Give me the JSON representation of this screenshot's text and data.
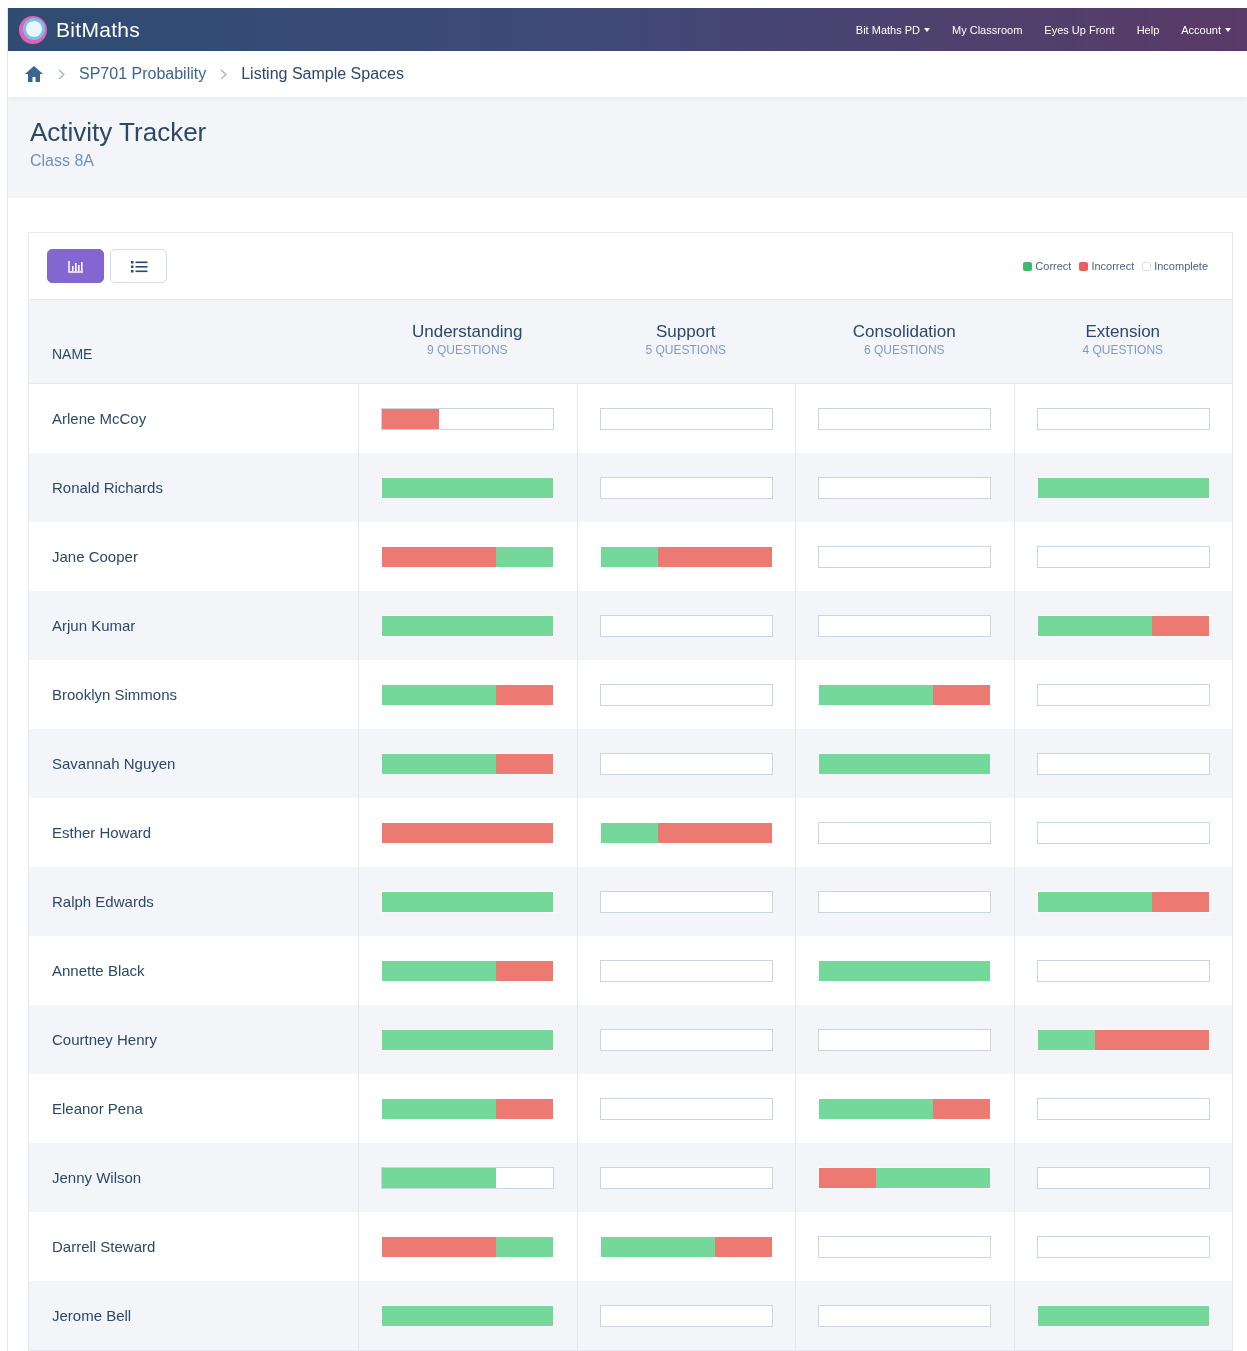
{
  "navbar": {
    "brand": "BitMaths",
    "links": [
      {
        "label": "Bit Maths PD",
        "dropdown": true
      },
      {
        "label": "My Classroom",
        "dropdown": false
      },
      {
        "label": "Eyes Up Front",
        "dropdown": false
      },
      {
        "label": "Help",
        "dropdown": false
      },
      {
        "label": "Account",
        "dropdown": true
      }
    ]
  },
  "breadcrumb": [
    "SP701 Probability",
    "Listing Sample Spaces"
  ],
  "page": {
    "title": "Activity Tracker",
    "subtitle": "Class 8A"
  },
  "view_buttons": [
    {
      "kind": "chart",
      "selected": true
    },
    {
      "kind": "list",
      "selected": false
    }
  ],
  "legend": [
    {
      "label": "Correct",
      "color": "#3dba6b"
    },
    {
      "label": "Incorrect",
      "color": "#e5615c"
    },
    {
      "label": "Incomplete",
      "color": "#ffffff"
    }
  ],
  "table": {
    "name_column": "NAME",
    "columns": [
      {
        "title": "Understanding",
        "count": "9 QUESTIONS"
      },
      {
        "title": "Support",
        "count": "5 QUESTIONS"
      },
      {
        "title": "Consolidation",
        "count": "6 QUESTIONS"
      },
      {
        "title": "Extension",
        "count": "4 QUESTIONS"
      }
    ],
    "rows": [
      {
        "name": "Arlene McCoy",
        "cells": [
          {
            "complete": false,
            "segments": [
              {
                "kind": "incorrect",
                "level": 0.333
              }
            ]
          },
          {
            "complete": false
          },
          {
            "complete": false
          },
          {
            "complete": false
          }
        ]
      },
      {
        "name": "Ronald Richards",
        "cells": [
          {
            "complete": true,
            "segments": [
              {
                "kind": "correct",
                "level": 1
              }
            ]
          },
          {
            "complete": false
          },
          {
            "complete": false
          },
          {
            "complete": true,
            "segments": [
              {
                "kind": "correct",
                "level": 1
              }
            ]
          }
        ]
      },
      {
        "name": "Jane Cooper",
        "cells": [
          {
            "complete": true,
            "segments": [
              {
                "kind": "incorrect",
                "level": 0.667
              },
              {
                "kind": "correct",
                "level": 0.333
              }
            ]
          },
          {
            "complete": true,
            "segments": [
              {
                "kind": "correct",
                "level": 0.333
              },
              {
                "kind": "incorrect",
                "level": 0.667
              }
            ]
          },
          {
            "complete": false
          },
          {
            "complete": false
          }
        ]
      },
      {
        "name": "Arjun Kumar",
        "cells": [
          {
            "complete": true,
            "segments": [
              {
                "kind": "correct",
                "level": 1
              }
            ]
          },
          {
            "complete": false
          },
          {
            "complete": false
          },
          {
            "complete": true,
            "segments": [
              {
                "kind": "correct",
                "level": 0.667
              },
              {
                "kind": "incorrect",
                "level": 0.333
              }
            ]
          }
        ]
      },
      {
        "name": "Brooklyn Simmons",
        "cells": [
          {
            "complete": true,
            "segments": [
              {
                "kind": "correct",
                "level": 0.667
              },
              {
                "kind": "incorrect",
                "level": 0.333
              }
            ]
          },
          {
            "complete": false
          },
          {
            "complete": true,
            "segments": [
              {
                "kind": "correct",
                "level": 0.667
              },
              {
                "kind": "incorrect",
                "level": 0.333
              }
            ]
          },
          {
            "complete": false
          }
        ]
      },
      {
        "name": "Savannah Nguyen",
        "cells": [
          {
            "complete": true,
            "segments": [
              {
                "kind": "correct",
                "level": 0.667
              },
              {
                "kind": "incorrect",
                "level": 0.333
              }
            ]
          },
          {
            "complete": false
          },
          {
            "complete": true,
            "segments": [
              {
                "kind": "correct",
                "level": 1
              }
            ]
          },
          {
            "complete": false
          }
        ]
      },
      {
        "name": "Esther Howard",
        "cells": [
          {
            "complete": true,
            "segments": [
              {
                "kind": "incorrect",
                "level": 1
              }
            ]
          },
          {
            "complete": true,
            "segments": [
              {
                "kind": "correct",
                "level": 0.333
              },
              {
                "kind": "incorrect",
                "level": 0.667
              }
            ]
          },
          {
            "complete": false
          },
          {
            "complete": false
          }
        ]
      },
      {
        "name": "Ralph Edwards",
        "cells": [
          {
            "complete": true,
            "segments": [
              {
                "kind": "correct",
                "level": 1
              }
            ]
          },
          {
            "complete": false
          },
          {
            "complete": false
          },
          {
            "complete": true,
            "segments": [
              {
                "kind": "correct",
                "level": 0.667
              },
              {
                "kind": "incorrect",
                "level": 0.333
              }
            ]
          }
        ]
      },
      {
        "name": "Annette Black",
        "cells": [
          {
            "complete": true,
            "segments": [
              {
                "kind": "correct",
                "level": 0.667
              },
              {
                "kind": "incorrect",
                "level": 0.333
              }
            ]
          },
          {
            "complete": false
          },
          {
            "complete": true,
            "segments": [
              {
                "kind": "correct",
                "level": 1
              }
            ]
          },
          {
            "complete": false
          }
        ]
      },
      {
        "name": "Courtney Henry",
        "cells": [
          {
            "complete": true,
            "segments": [
              {
                "kind": "correct",
                "level": 1
              }
            ]
          },
          {
            "complete": false
          },
          {
            "complete": false
          },
          {
            "complete": true,
            "segments": [
              {
                "kind": "correct",
                "level": 0.333
              },
              {
                "kind": "incorrect",
                "level": 0.667
              }
            ]
          }
        ]
      },
      {
        "name": "Eleanor Pena",
        "cells": [
          {
            "complete": true,
            "segments": [
              {
                "kind": "correct",
                "level": 0.667
              },
              {
                "kind": "incorrect",
                "level": 0.333
              }
            ]
          },
          {
            "complete": false
          },
          {
            "complete": true,
            "segments": [
              {
                "kind": "correct",
                "level": 0.667
              },
              {
                "kind": "incorrect",
                "level": 0.333
              }
            ]
          },
          {
            "complete": false
          }
        ]
      },
      {
        "name": "Jenny Wilson",
        "cells": [
          {
            "complete": false,
            "segments": [
              {
                "kind": "correct",
                "level": 0.667
              }
            ]
          },
          {
            "complete": false
          },
          {
            "complete": true,
            "segments": [
              {
                "kind": "incorrect",
                "level": 0.333
              },
              {
                "kind": "correct",
                "level": 0.667
              }
            ]
          },
          {
            "complete": false
          }
        ]
      },
      {
        "name": "Darrell Steward",
        "cells": [
          {
            "complete": true,
            "segments": [
              {
                "kind": "incorrect",
                "level": 0.667
              },
              {
                "kind": "correct",
                "level": 0.333
              }
            ]
          },
          {
            "complete": true,
            "segments": [
              {
                "kind": "correct",
                "level": 0.667
              },
              {
                "kind": "incorrect",
                "level": 0.333
              }
            ]
          },
          {
            "complete": false
          },
          {
            "complete": false
          }
        ]
      },
      {
        "name": "Jerome Bell",
        "cells": [
          {
            "complete": true,
            "segments": [
              {
                "kind": "correct",
                "level": 1
              }
            ]
          },
          {
            "complete": false
          },
          {
            "complete": false
          },
          {
            "complete": true,
            "segments": [
              {
                "kind": "correct",
                "level": 1
              }
            ]
          }
        ]
      }
    ]
  }
}
